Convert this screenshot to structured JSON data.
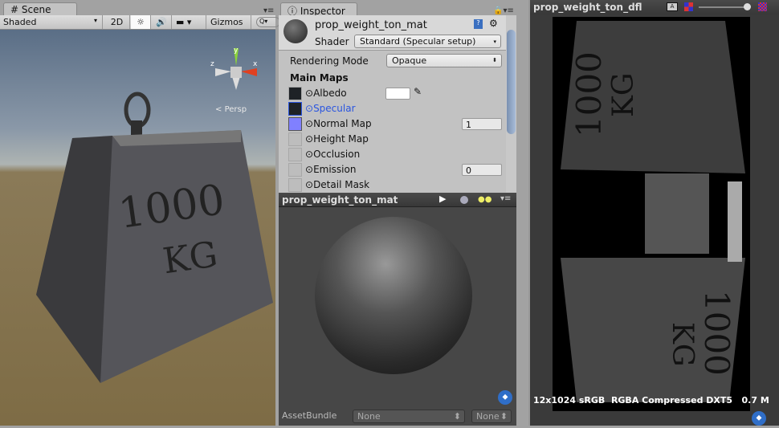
{
  "scene": {
    "tab": "Scene",
    "shading": "Shaded",
    "mode_2d": "2D",
    "gizmos": "Gizmos",
    "persp": "Persp",
    "label_1000": "1000",
    "label_kg": "KG",
    "axis_x": "x",
    "axis_y": "y",
    "axis_z": "z"
  },
  "inspector": {
    "tab": "Inspector",
    "material_name": "prop_weight_ton_mat",
    "shader_label": "Shader",
    "shader_value": "Standard (Specular setup)",
    "rendering_mode_label": "Rendering Mode",
    "rendering_mode_value": "Opaque",
    "main_maps": "Main Maps",
    "maps": [
      {
        "label": "Albedo"
      },
      {
        "label": "Specular"
      },
      {
        "label": "Normal Map",
        "value": "1"
      },
      {
        "label": "Height Map"
      },
      {
        "label": "Occlusion"
      },
      {
        "label": "Emission",
        "value": "0"
      },
      {
        "label": "Detail Mask"
      }
    ],
    "accent": "#2a55e0"
  },
  "preview": {
    "title": "prop_weight_ton_mat",
    "asset_bundle_label": "AssetBundle",
    "asset_bundle_value": "None",
    "variant_value": "None"
  },
  "texture": {
    "title": "prop_weight_ton_dfl",
    "mip_label": "A",
    "info": "12x1024 sRGB  RGBA Compressed DXT5   0.7 M",
    "label_1000": "1000",
    "label_kg": "KG"
  }
}
